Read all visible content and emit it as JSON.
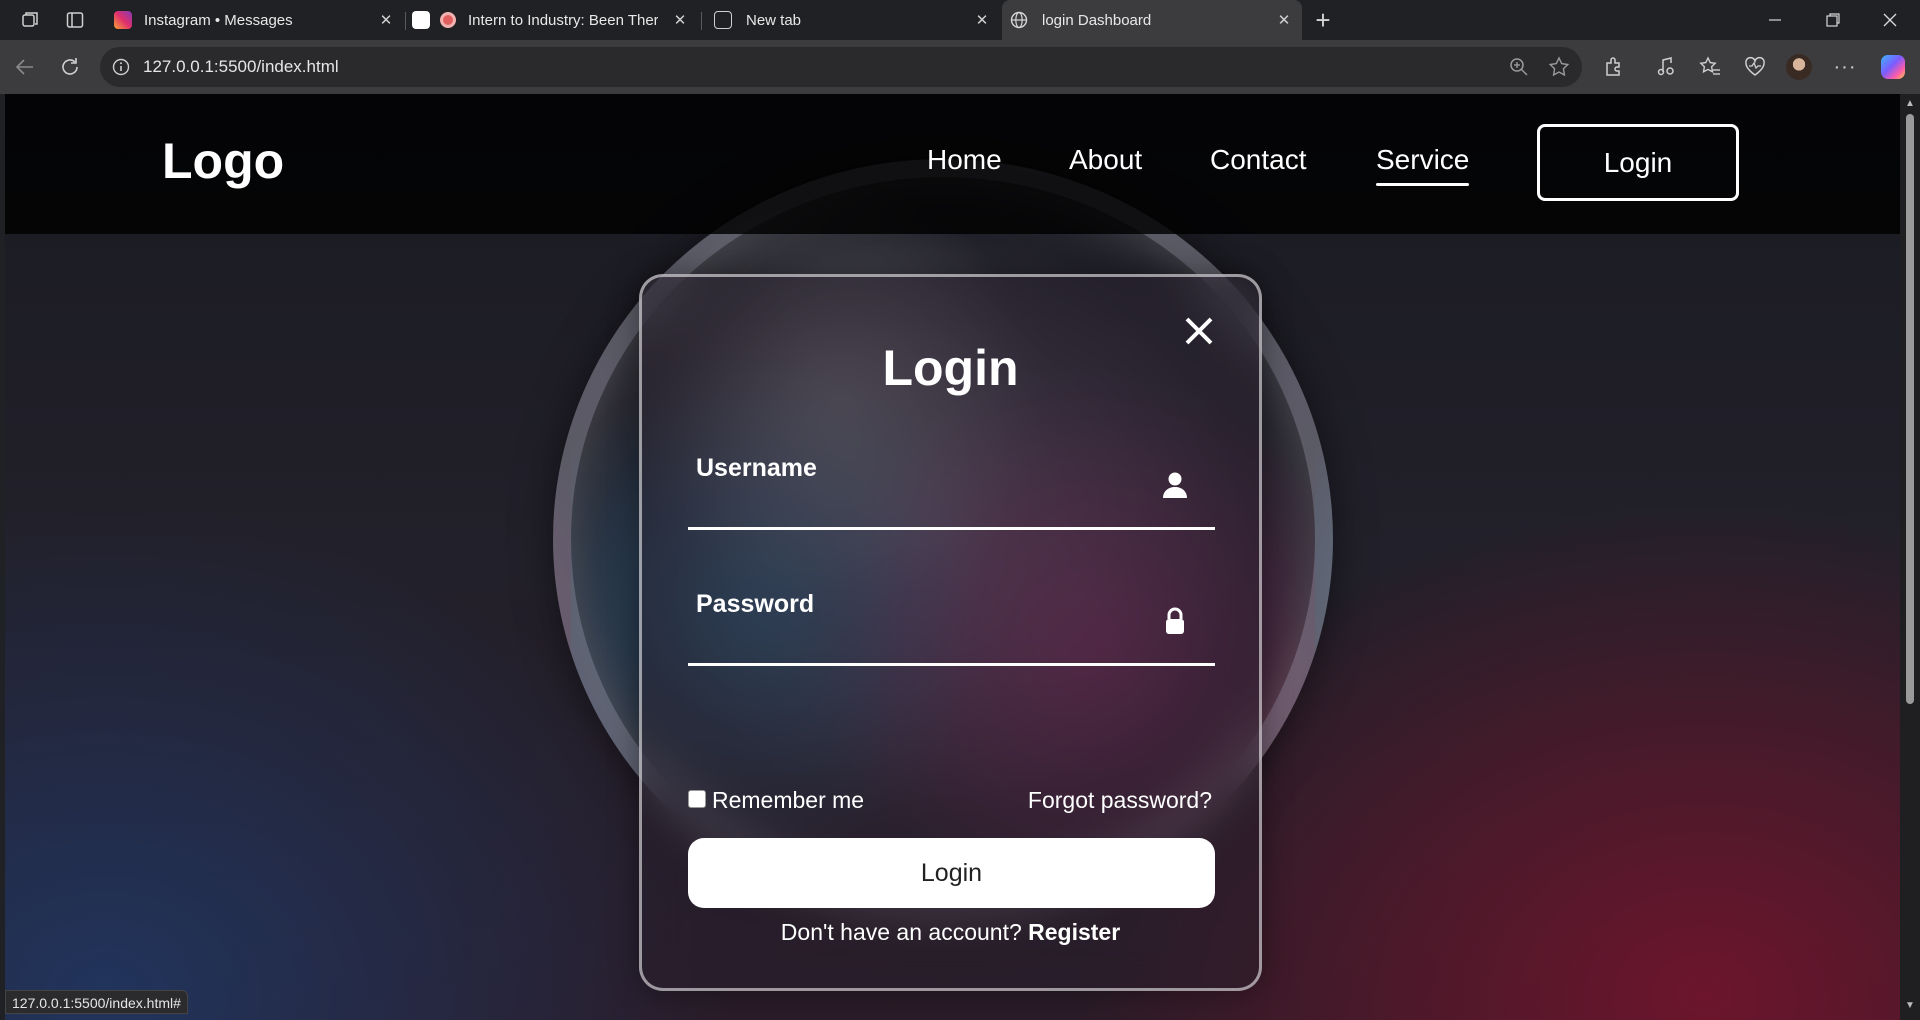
{
  "browser": {
    "tabs": [
      {
        "title": "Instagram • Messages",
        "icon": "instagram-icon"
      },
      {
        "title": "Intern to Industry: Been Ther",
        "icon": "recording-icon"
      },
      {
        "title": "New tab",
        "icon": "new-tab-icon"
      },
      {
        "title": "login Dashboard",
        "icon": "globe-icon",
        "active": true
      }
    ],
    "url": "127.0.0.1:5500/index.html",
    "status_url": "127.0.0.1:5500/index.html#"
  },
  "page": {
    "logo": "Logo",
    "nav": [
      "Home",
      "About",
      "Contact",
      "Service"
    ],
    "active_nav": "Service",
    "header_login": "Login"
  },
  "modal": {
    "title": "Login",
    "username_label": "Username",
    "password_label": "Password",
    "remember": "Remember me",
    "forgot": "Forgot password?",
    "submit": "Login",
    "no_account": "Don't have an account?",
    "register": "Register"
  }
}
